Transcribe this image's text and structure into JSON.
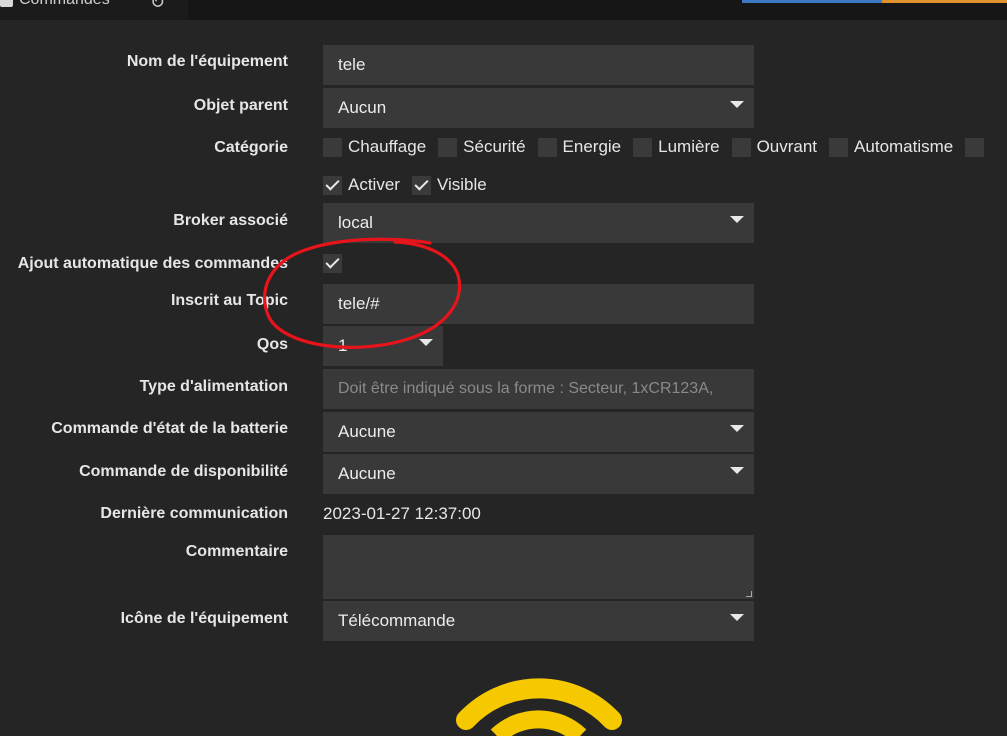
{
  "topbar": {
    "tab_label": "Commandes"
  },
  "form": {
    "name": {
      "label": "Nom de l'équipement",
      "value": "tele"
    },
    "parent": {
      "label": "Objet parent",
      "value": "Aucun"
    },
    "category": {
      "label": "Catégorie",
      "options": [
        {
          "label": "Chauffage",
          "checked": false
        },
        {
          "label": "Sécurité",
          "checked": false
        },
        {
          "label": "Energie",
          "checked": false
        },
        {
          "label": "Lumière",
          "checked": false
        },
        {
          "label": "Ouvrant",
          "checked": false
        },
        {
          "label": "Automatisme",
          "checked": false
        }
      ]
    },
    "flags": {
      "activate": "Activer",
      "visible": "Visible"
    },
    "broker": {
      "label": "Broker associé",
      "value": "local"
    },
    "auto_add": {
      "label": "Ajout automatique des commandes",
      "checked": true
    },
    "topic": {
      "label": "Inscrit au Topic",
      "value": "tele/#"
    },
    "qos": {
      "label": "Qos",
      "value": "1"
    },
    "power_type": {
      "label": "Type d'alimentation",
      "placeholder": "Doit être indiqué sous la forme : Secteur, 1xCR123A,"
    },
    "battery_cmd": {
      "label": "Commande d'état de la batterie",
      "value": "Aucune"
    },
    "availability_cmd": {
      "label": "Commande de disponibilité",
      "value": "Aucune"
    },
    "last_comm": {
      "label": "Dernière communication",
      "value": "2023-01-27 12:37:00"
    },
    "comment": {
      "label": "Commentaire",
      "value": ""
    },
    "icon": {
      "label": "Icône de l'équipement",
      "value": "Télécommande"
    }
  },
  "colors": {
    "annotation": "#e8141c",
    "icon_accent": "#f5c800"
  }
}
